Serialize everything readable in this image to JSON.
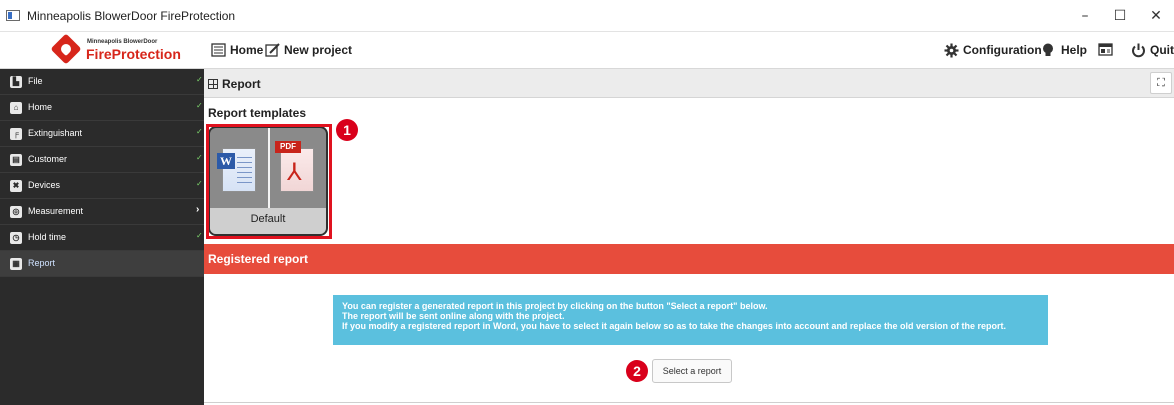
{
  "window": {
    "title": "Minneapolis BlowerDoor FireProtection",
    "controls": {
      "minimize": "–",
      "maximize": "☐",
      "close": "✕"
    }
  },
  "logo": {
    "small_text": "Minneapolis BlowerDoor",
    "big_text": "FireProtection"
  },
  "toolbar": {
    "home_label": "Home",
    "new_project_label": "New project",
    "configuration_label": "Configuration",
    "help_label": "Help",
    "quit_label": "Quit"
  },
  "sidebar": {
    "items": [
      {
        "label": "File",
        "icon": "file-icon",
        "glyph": "▙",
        "status": "✓"
      },
      {
        "label": "Home",
        "icon": "home-icon",
        "glyph": "⌂",
        "status": "✓"
      },
      {
        "label": "Extinguishant",
        "icon": "extinguisher-icon",
        "glyph": "╒",
        "status": "✓"
      },
      {
        "label": "Customer",
        "icon": "customer-icon",
        "glyph": "▤",
        "status": "✓"
      },
      {
        "label": "Devices",
        "icon": "devices-icon",
        "glyph": "✖",
        "status": "✓"
      },
      {
        "label": "Measurement",
        "icon": "measurement-icon",
        "glyph": "◎",
        "status": "›"
      },
      {
        "label": "Hold time",
        "icon": "stopwatch-icon",
        "glyph": "◷",
        "status": "✓"
      },
      {
        "label": "Report",
        "icon": "report-icon",
        "glyph": "▦",
        "status": ""
      }
    ]
  },
  "main": {
    "header_title": "Report",
    "expand_glyph": "⛶",
    "templates_title": "Report templates",
    "template": {
      "caption": "Default",
      "word_letter": "W",
      "pdf_tag": "PDF",
      "pdf_glyph": "⅄"
    },
    "registered_title": "Registered report",
    "info_lines": [
      "You can register a generated report in this project by clicking on the button \"Select a report\" below.",
      "The report will be sent online along with the project.",
      "If you modify a registered report in Word, you have to select it again below so as to take the changes into account and replace the old version of the report."
    ],
    "select_button_label": "Select a report"
  },
  "annotations": {
    "step1": "1",
    "step2": "2"
  },
  "colors": {
    "sidebar_bg": "#2b2b2b",
    "accent_red": "#e74c3c",
    "info_blue": "#5bc0de",
    "annotation_red": "#d9001b",
    "check_green": "#7bd36b"
  }
}
